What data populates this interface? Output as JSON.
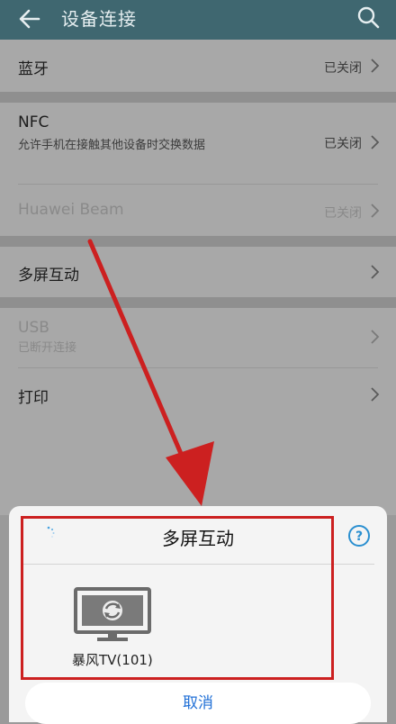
{
  "header": {
    "title": "设备连接"
  },
  "rows": {
    "bluetooth": {
      "label": "蓝牙",
      "state": "已关闭"
    },
    "nfc": {
      "label": "NFC",
      "sub": "允许手机在接触其他设备时交换数据",
      "state": "已关闭"
    },
    "huawei_beam": {
      "label": "Huawei Beam",
      "state": "已关闭"
    },
    "multiscreen": {
      "label": "多屏互动"
    },
    "usb": {
      "label": "USB",
      "sub": "已断开连接"
    },
    "print": {
      "label": "打印"
    }
  },
  "sheet": {
    "title": "多屏互动",
    "device_name": "暴风TV(101)",
    "cancel_label": "取消"
  },
  "colors": {
    "header_bg": "#3f6770",
    "annotation_red": "#cc2020",
    "cancel_text": "#1f6fd6"
  }
}
